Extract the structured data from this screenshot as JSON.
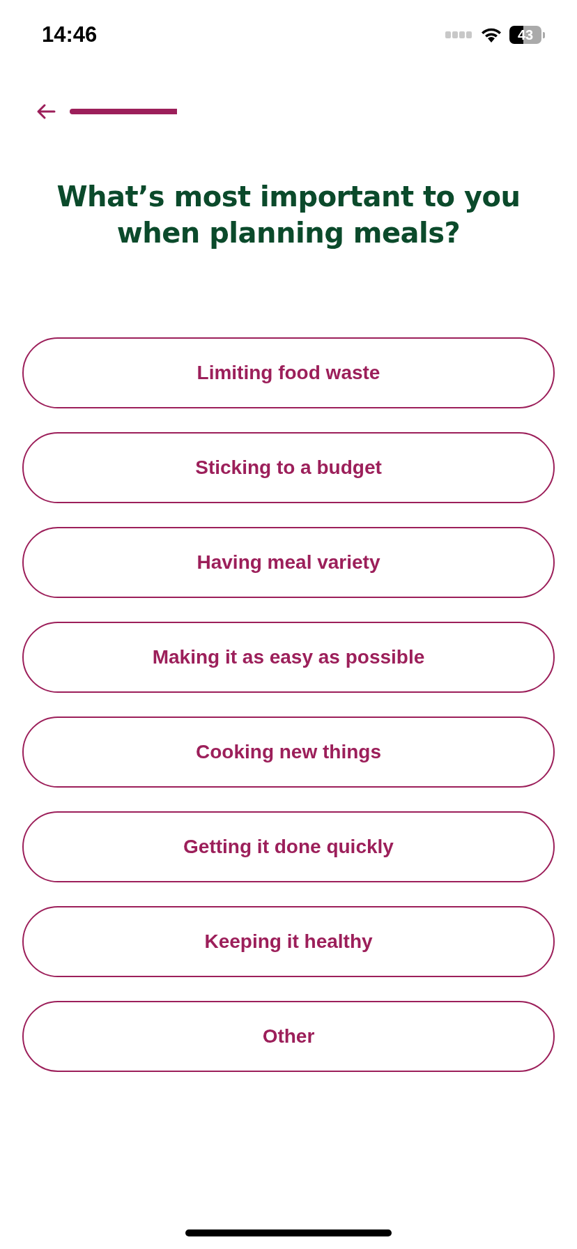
{
  "status_bar": {
    "time": "14:46",
    "battery": "43"
  },
  "title": "What’s most important to you when planning meals?",
  "options": [
    {
      "label": "Limiting food waste",
      "selected": false
    },
    {
      "label": "Sticking to a budget",
      "selected": false
    },
    {
      "label": "Having meal variety",
      "selected": false
    },
    {
      "label": "Making it as easy as possible",
      "selected": false
    },
    {
      "label": "Cooking new things",
      "selected": false
    },
    {
      "label": "Getting it done quickly",
      "selected": false
    },
    {
      "label": "Keeping it healthy",
      "selected": false
    },
    {
      "label": "Other",
      "selected": false
    }
  ]
}
